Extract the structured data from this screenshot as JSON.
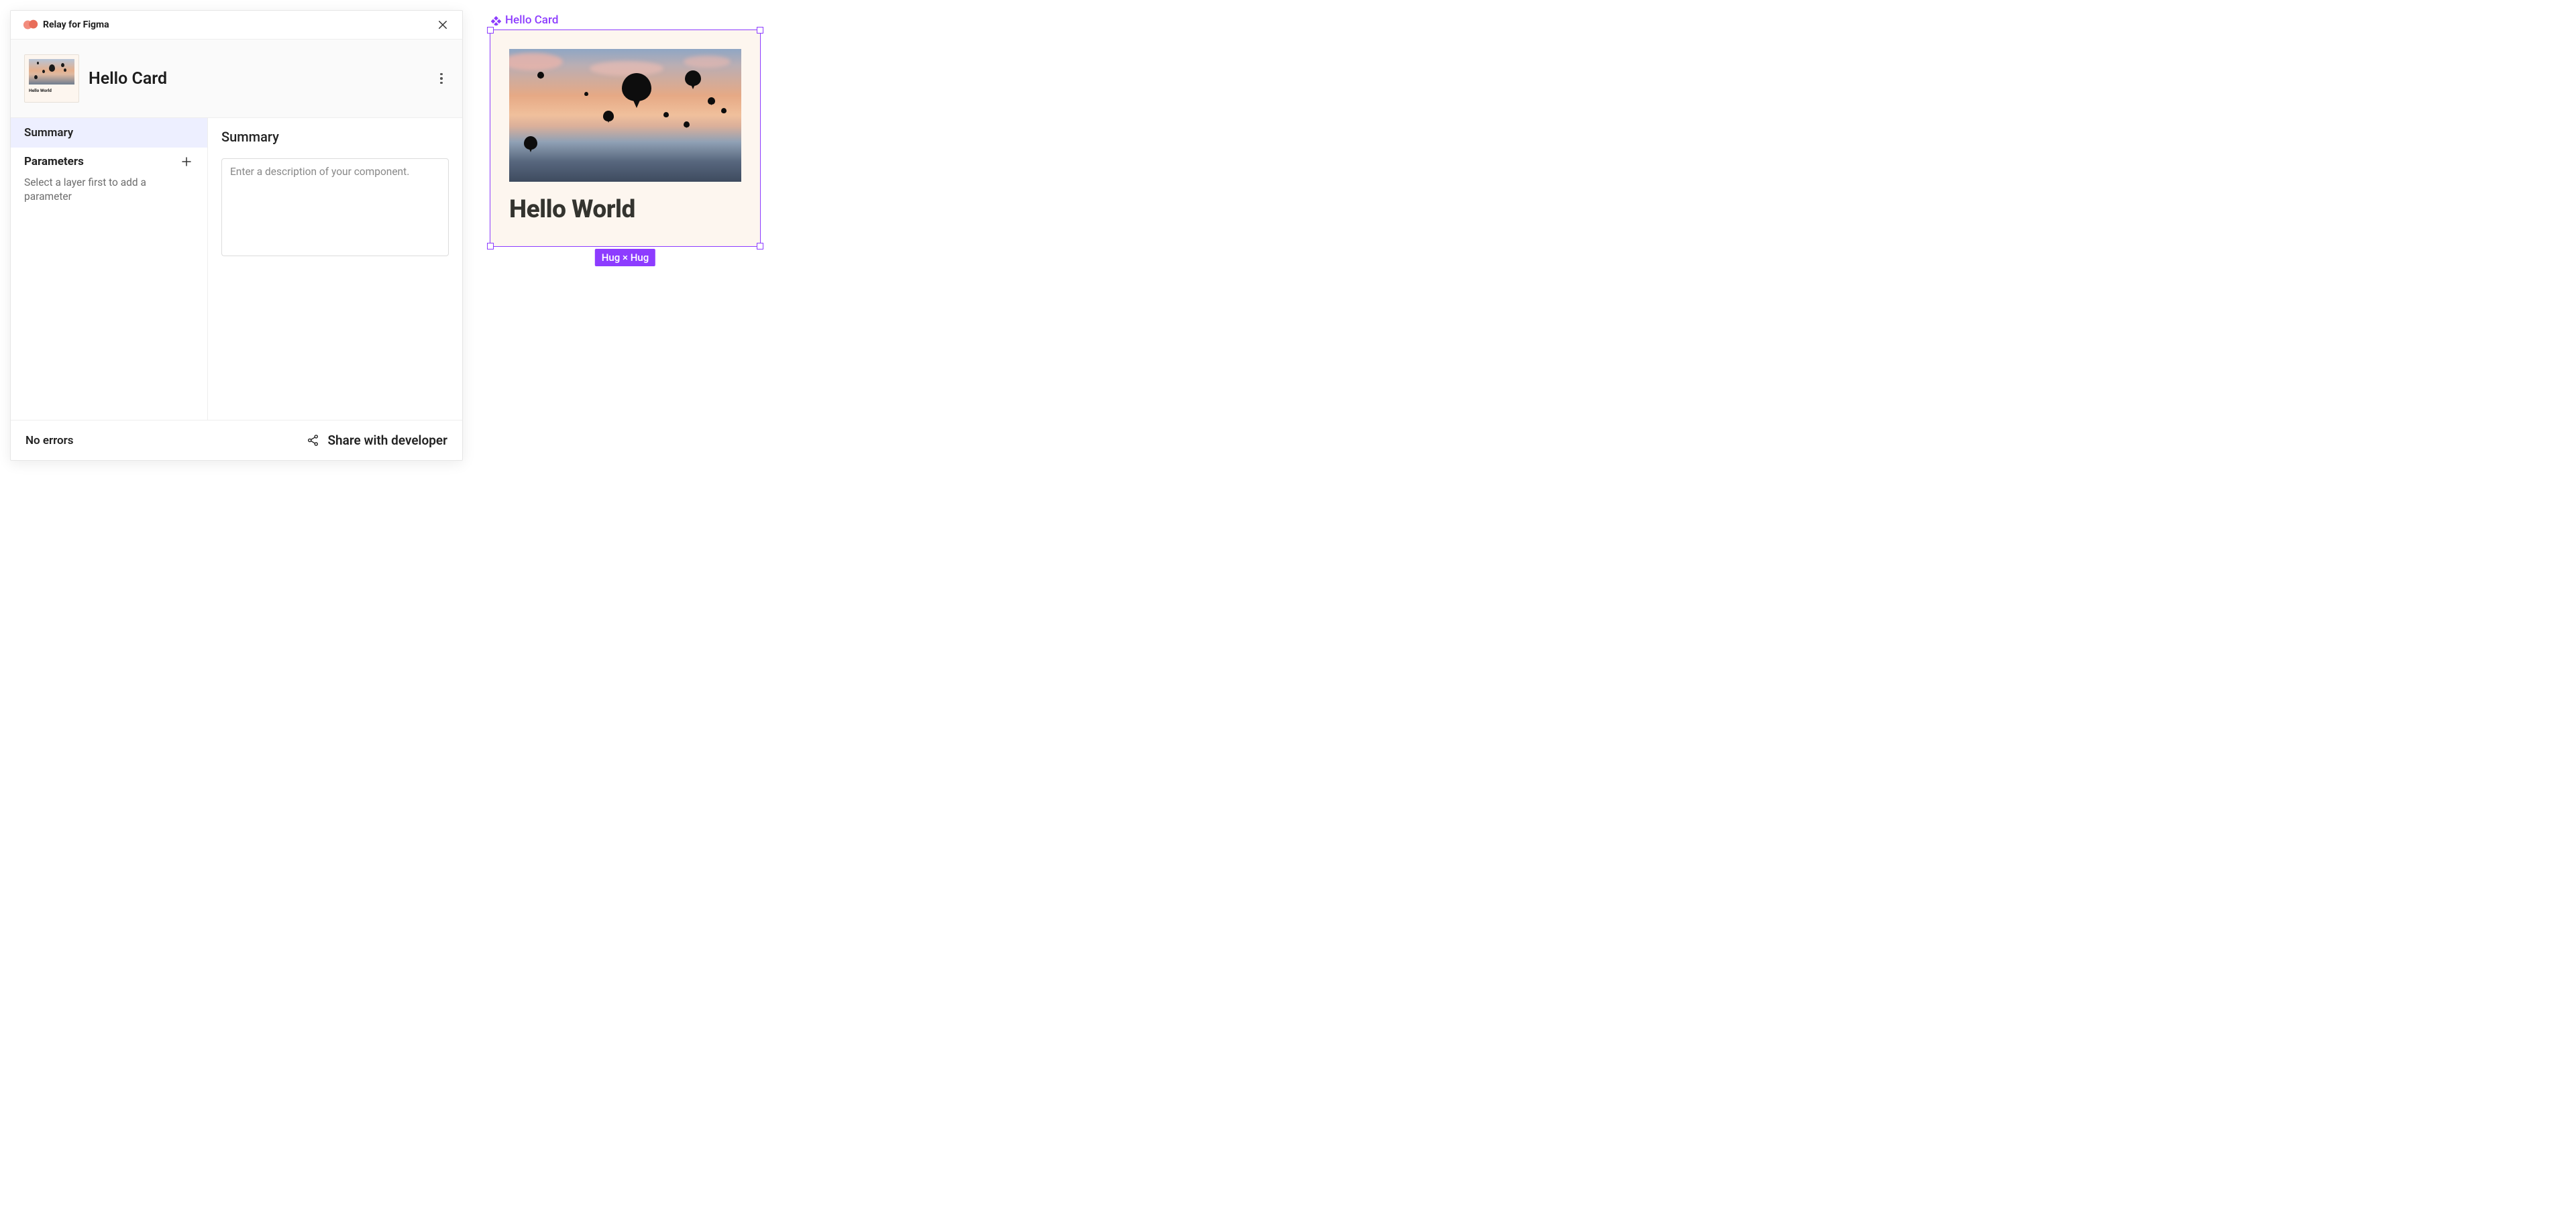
{
  "panel": {
    "plugin_title": "Relay for Figma",
    "component_name": "Hello Card",
    "thumbnail": {
      "caption": "Hello World"
    },
    "sidebar": {
      "tabs": [
        {
          "label": "Summary",
          "active": true
        }
      ],
      "parameters": {
        "title": "Parameters",
        "help": "Select a layer first to add a parameter"
      }
    },
    "main": {
      "heading": "Summary",
      "description_placeholder": "Enter a description of your component.",
      "description_value": ""
    },
    "footer": {
      "status": "No errors",
      "share_label": "Share with developer"
    }
  },
  "canvas": {
    "component_label": "Hello Card",
    "card_title": "Hello World",
    "size_badge": "Hug × Hug",
    "colors": {
      "selection": "#8d3cff",
      "card_bg": "#fdf6ef"
    }
  }
}
